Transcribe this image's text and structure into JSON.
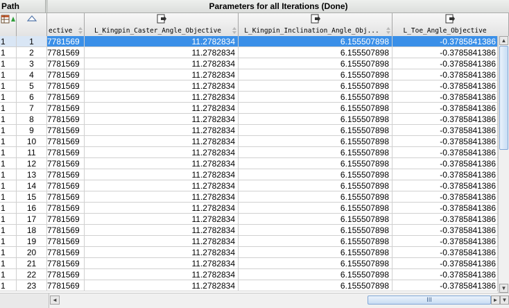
{
  "titlebar": {
    "path_label": "Path",
    "title": "Parameters for all Iterations (Done)"
  },
  "columns": {
    "objective_partial": "ective",
    "caster": "L_Kingpin_Caster_Angle_Objective",
    "inclination": "L_Kingpin_Inclination_Angle_Obj...",
    "toe": "L_Toe_Angle_Objective"
  },
  "rows": [
    {
      "path": "1",
      "idx": "1",
      "obj": "7781569",
      "caster": "11.2782834",
      "incl": "6.155507898",
      "toe": "-0.3785841386"
    },
    {
      "path": "1",
      "idx": "2",
      "obj": "7781569",
      "caster": "11.2782834",
      "incl": "6.155507898",
      "toe": "-0.3785841386"
    },
    {
      "path": "1",
      "idx": "3",
      "obj": "7781569",
      "caster": "11.2782834",
      "incl": "6.155507898",
      "toe": "-0.3785841386"
    },
    {
      "path": "1",
      "idx": "4",
      "obj": "7781569",
      "caster": "11.2782834",
      "incl": "6.155507898",
      "toe": "-0.3785841386"
    },
    {
      "path": "1",
      "idx": "5",
      "obj": "7781569",
      "caster": "11.2782834",
      "incl": "6.155507898",
      "toe": "-0.3785841386"
    },
    {
      "path": "1",
      "idx": "6",
      "obj": "7781569",
      "caster": "11.2782834",
      "incl": "6.155507898",
      "toe": "-0.3785841386"
    },
    {
      "path": "1",
      "idx": "7",
      "obj": "7781569",
      "caster": "11.2782834",
      "incl": "6.155507898",
      "toe": "-0.3785841386"
    },
    {
      "path": "1",
      "idx": "8",
      "obj": "7781569",
      "caster": "11.2782834",
      "incl": "6.155507898",
      "toe": "-0.3785841386"
    },
    {
      "path": "1",
      "idx": "9",
      "obj": "7781569",
      "caster": "11.2782834",
      "incl": "6.155507898",
      "toe": "-0.3785841386"
    },
    {
      "path": "1",
      "idx": "10",
      "obj": "7781569",
      "caster": "11.2782834",
      "incl": "6.155507898",
      "toe": "-0.3785841386"
    },
    {
      "path": "1",
      "idx": "11",
      "obj": "7781569",
      "caster": "11.2782834",
      "incl": "6.155507898",
      "toe": "-0.3785841386"
    },
    {
      "path": "1",
      "idx": "12",
      "obj": "7781569",
      "caster": "11.2782834",
      "incl": "6.155507898",
      "toe": "-0.3785841386"
    },
    {
      "path": "1",
      "idx": "13",
      "obj": "7781569",
      "caster": "11.2782834",
      "incl": "6.155507898",
      "toe": "-0.3785841386"
    },
    {
      "path": "1",
      "idx": "14",
      "obj": "7781569",
      "caster": "11.2782834",
      "incl": "6.155507898",
      "toe": "-0.3785841386"
    },
    {
      "path": "1",
      "idx": "15",
      "obj": "7781569",
      "caster": "11.2782834",
      "incl": "6.155507898",
      "toe": "-0.3785841386"
    },
    {
      "path": "1",
      "idx": "16",
      "obj": "7781569",
      "caster": "11.2782834",
      "incl": "6.155507898",
      "toe": "-0.3785841386"
    },
    {
      "path": "1",
      "idx": "17",
      "obj": "7781569",
      "caster": "11.2782834",
      "incl": "6.155507898",
      "toe": "-0.3785841386"
    },
    {
      "path": "1",
      "idx": "18",
      "obj": "7781569",
      "caster": "11.2782834",
      "incl": "6.155507898",
      "toe": "-0.3785841386"
    },
    {
      "path": "1",
      "idx": "19",
      "obj": "7781569",
      "caster": "11.2782834",
      "incl": "6.155507898",
      "toe": "-0.3785841386"
    },
    {
      "path": "1",
      "idx": "20",
      "obj": "7781569",
      "caster": "11.2782834",
      "incl": "6.155507898",
      "toe": "-0.3785841386"
    },
    {
      "path": "1",
      "idx": "21",
      "obj": "7781569",
      "caster": "11.2782834",
      "incl": "6.155507898",
      "toe": "-0.3785841386"
    },
    {
      "path": "1",
      "idx": "22",
      "obj": "7781569",
      "caster": "11.2782834",
      "incl": "6.155507898",
      "toe": "-0.3785841386"
    },
    {
      "path": "1",
      "idx": "23",
      "obj": "7781569",
      "caster": "11.2782834",
      "incl": "6.155507898",
      "toe": "-0.3785841386"
    }
  ],
  "selected_row_index": 0,
  "scrollbar": {
    "thumb_grip": "III",
    "arrow_left": "◄",
    "arrow_right": "►",
    "arrow_up": "▲",
    "arrow_down": "▼"
  },
  "colors": {
    "selection": "#3a8fe8",
    "header_bg": "#e6e6e6"
  },
  "icons": {
    "grid": "table-icon",
    "sort": "sort-asc-icon",
    "export": "export-icon"
  }
}
